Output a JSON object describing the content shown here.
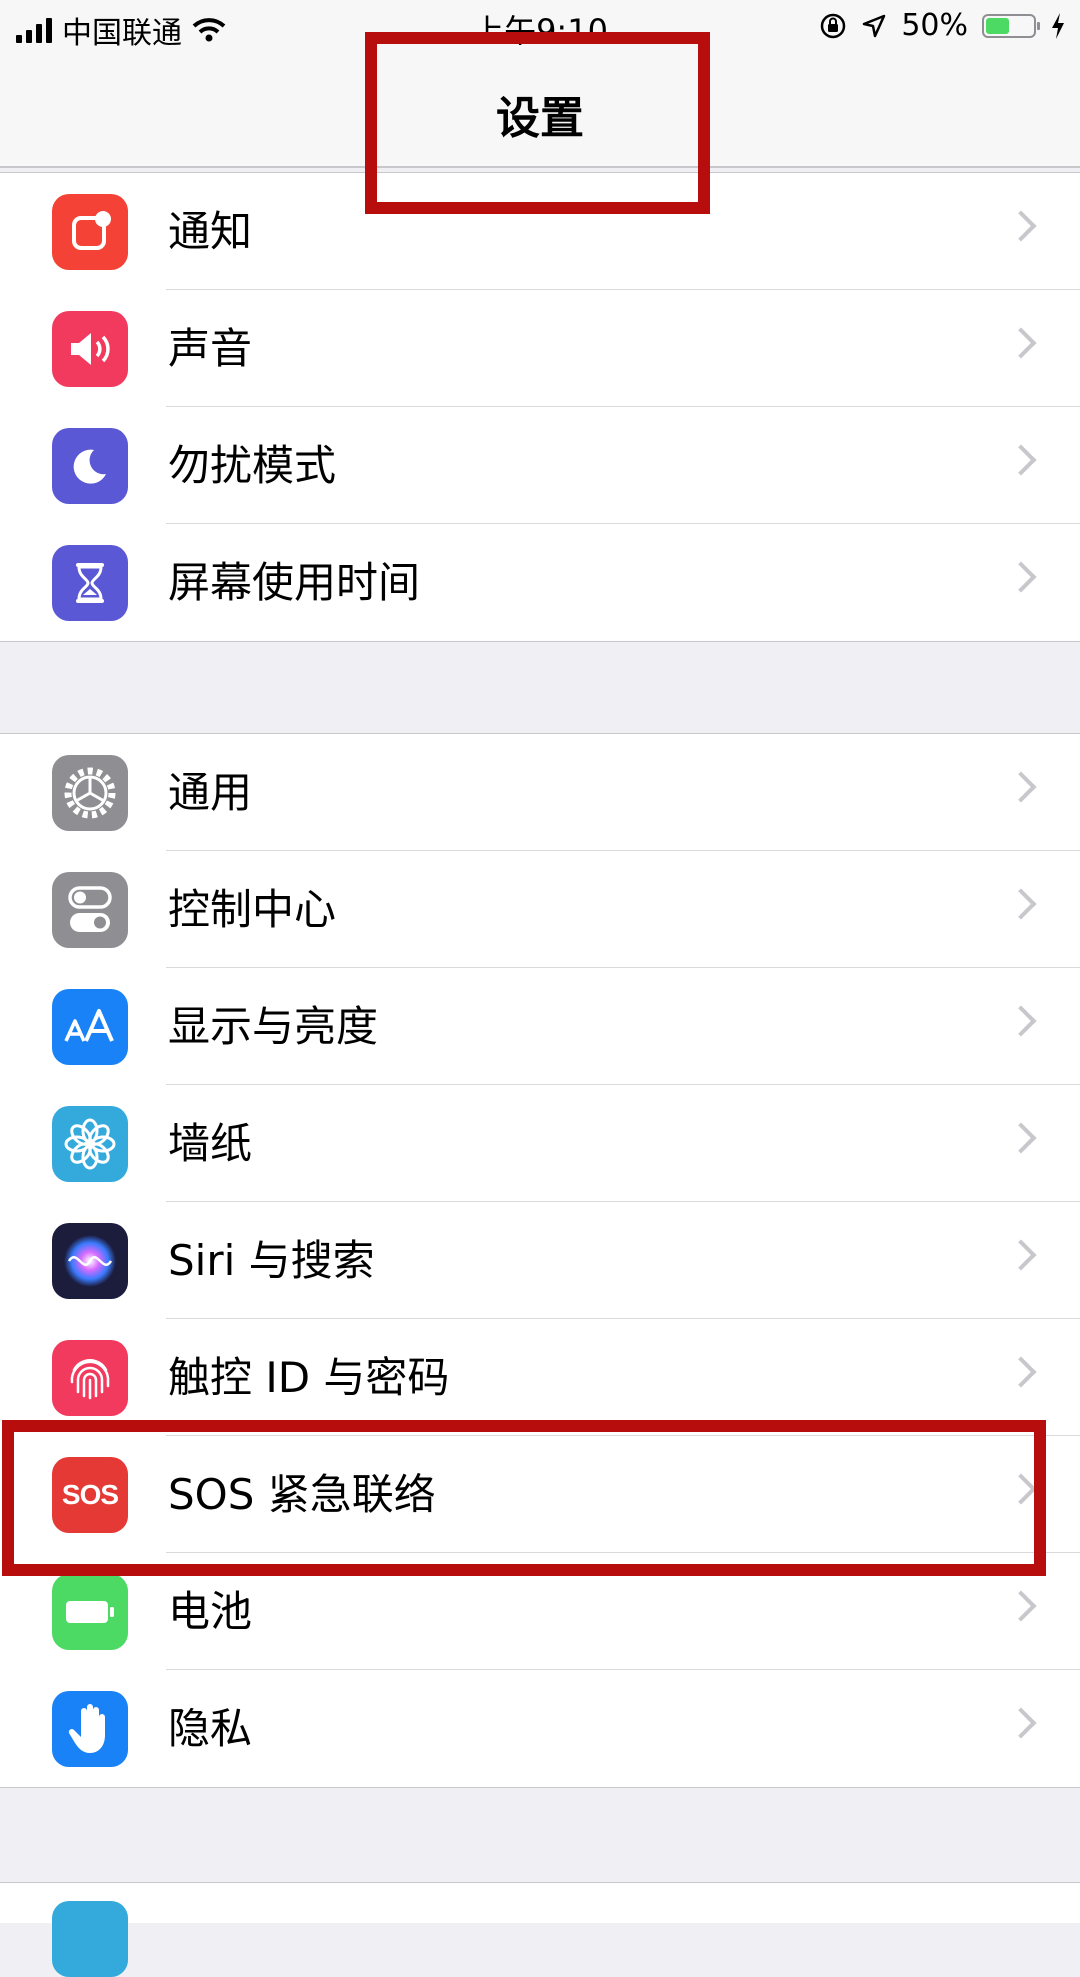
{
  "status_bar": {
    "carrier": "中国联通",
    "time": "上午9:10",
    "battery_percent_text": "50%",
    "battery_level": 0.5
  },
  "nav": {
    "title": "设置"
  },
  "groups": [
    {
      "items": [
        {
          "label": "通知",
          "icon": "notifications-icon",
          "color": "#f44336"
        },
        {
          "label": "声音",
          "icon": "sound-icon",
          "color": "#f23a5f"
        },
        {
          "label": "勿扰模式",
          "icon": "moon-icon",
          "color": "#5b58d6"
        },
        {
          "label": "屏幕使用时间",
          "icon": "hourglass-icon",
          "color": "#5b58d6"
        }
      ]
    },
    {
      "items": [
        {
          "label": "通用",
          "icon": "gear-icon",
          "color": "#8e8e93"
        },
        {
          "label": "控制中心",
          "icon": "toggles-icon",
          "color": "#8e8e93"
        },
        {
          "label": "显示与亮度",
          "icon": "display-aa-icon",
          "color": "#1a82f7"
        },
        {
          "label": "墙纸",
          "icon": "flower-icon",
          "color": "#34aadc"
        },
        {
          "label": "Siri 与搜索",
          "icon": "siri-icon",
          "color": "#1c1c3c"
        },
        {
          "label": "触控 ID 与密码",
          "icon": "fingerprint-icon",
          "color": "#f23a5f"
        },
        {
          "label": "SOS 紧急联络",
          "icon": "sos-icon",
          "icon_text": "SOS",
          "color": "#e53935"
        },
        {
          "label": "电池",
          "icon": "battery-icon",
          "color": "#4cd964"
        },
        {
          "label": "隐私",
          "icon": "hand-icon",
          "color": "#1a82f7"
        }
      ]
    }
  ],
  "colors": {
    "annotation": "#b80d0d",
    "background": "#efeff4",
    "chevron": "#c7c7cc"
  }
}
